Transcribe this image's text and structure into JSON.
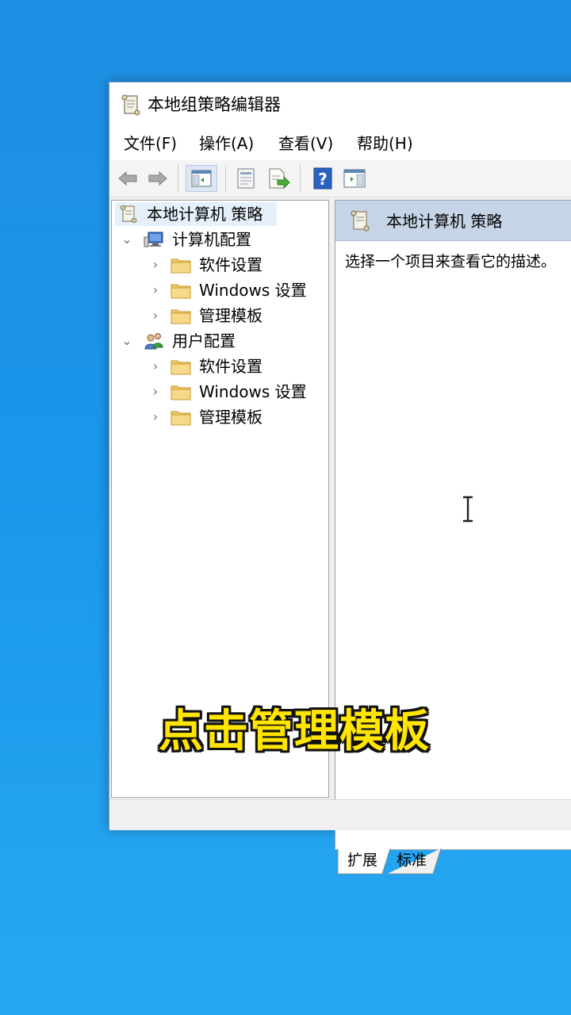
{
  "window": {
    "title": "本地组策略编辑器",
    "icon": "policy-scroll-icon"
  },
  "menu": {
    "items": [
      "文件(F)",
      "操作(A)",
      "查看(V)",
      "帮助(H)"
    ]
  },
  "toolbar": {
    "buttons": [
      "back-arrow-icon",
      "forward-arrow-icon",
      "show-hide-tree-icon",
      "properties-icon",
      "export-list-icon",
      "help-icon",
      "show-hide-action-pane-icon"
    ]
  },
  "tree": {
    "root": "本地计算机 策略",
    "computer": {
      "label": "计算机配置",
      "children": [
        "软件设置",
        "Windows 设置",
        "管理模板"
      ]
    },
    "user": {
      "label": "用户配置",
      "children": [
        "软件设置",
        "Windows 设置",
        "管理模板"
      ]
    }
  },
  "details": {
    "header": "本地计算机 策略",
    "description": "选择一个项目来查看它的描述。"
  },
  "tabs": [
    "扩展",
    "标准"
  ],
  "overlay_caption": "点击管理模板",
  "colors": {
    "desktop": "#1a96ea",
    "header_band": "#c5d4e6",
    "caption": "#ffe500"
  }
}
